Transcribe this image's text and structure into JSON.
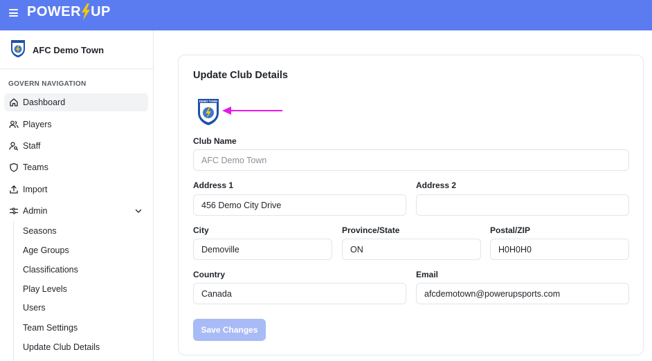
{
  "app": {
    "brand_left": "POWER",
    "brand_right": "UP"
  },
  "club": {
    "name": "AFC Demo Town"
  },
  "nav": {
    "heading": "GOVERN NAVIGATION",
    "items": [
      {
        "label": "Dashboard",
        "icon": "home-icon",
        "active": true
      },
      {
        "label": "Players",
        "icon": "users-icon"
      },
      {
        "label": "Staff",
        "icon": "user-search-icon"
      },
      {
        "label": "Teams",
        "icon": "shield-icon"
      },
      {
        "label": "Import",
        "icon": "upload-icon"
      },
      {
        "label": "Admin",
        "icon": "settings-sliders-icon",
        "expanded": true
      }
    ],
    "admin_sub": [
      "Seasons",
      "Age Groups",
      "Classifications",
      "Play Levels",
      "Users",
      "Team Settings",
      "Update Club Details"
    ]
  },
  "form": {
    "title": "Update Club Details",
    "logo_text": "DEMO TOWN",
    "club_name": {
      "label": "Club Name",
      "value": "AFC Demo Town"
    },
    "address1": {
      "label": "Address 1",
      "value": "456 Demo City Drive"
    },
    "address2": {
      "label": "Address 2",
      "value": ""
    },
    "city": {
      "label": "City",
      "value": "Demoville"
    },
    "province": {
      "label": "Province/State",
      "value": "ON"
    },
    "postal": {
      "label": "Postal/ZIP",
      "value": "H0H0H0"
    },
    "country": {
      "label": "Country",
      "value": "Canada"
    },
    "email": {
      "label": "Email",
      "value": "afcdemotown@powerupsports.com"
    },
    "save_label": "Save Changes"
  },
  "colors": {
    "topbar": "#5b7cf0",
    "save_button_disabled": "#a9bbf6",
    "annotation_arrow": "#e619e6",
    "bolt": "#f7c600"
  }
}
